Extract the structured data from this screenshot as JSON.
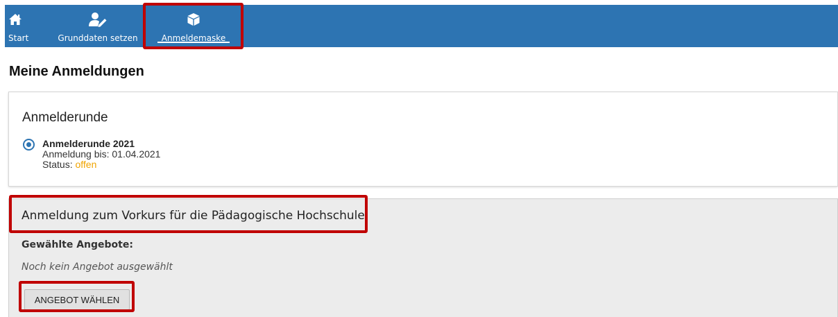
{
  "navbar": {
    "items": [
      {
        "label": "Start",
        "icon": "home-icon"
      },
      {
        "label": "Grunddaten setzen",
        "icon": "user-edit-icon"
      },
      {
        "label": "Anmeldemaske",
        "icon": "cube-icon",
        "active": true
      }
    ],
    "color": "#2d74b2"
  },
  "page": {
    "title": "Meine Anmeldungen"
  },
  "round_card": {
    "title": "Anmelderunde",
    "round": {
      "name": "Anmelderunde 2021",
      "deadline": "Anmeldung bis: 01.04.2021",
      "status_label": "Status:",
      "status_value": "offen",
      "selected": true
    }
  },
  "course_card": {
    "title": "Anmeldung zum Vorkurs für die Pädagogische Hochschule",
    "selected_heading": "Gewählte Angebote:",
    "empty_text": "Noch kein Angebot ausgewählt",
    "button_label": "ANGEBOT WÄHLEN"
  },
  "colors": {
    "highlight": "#c00000",
    "status_open": "#f0a400"
  }
}
